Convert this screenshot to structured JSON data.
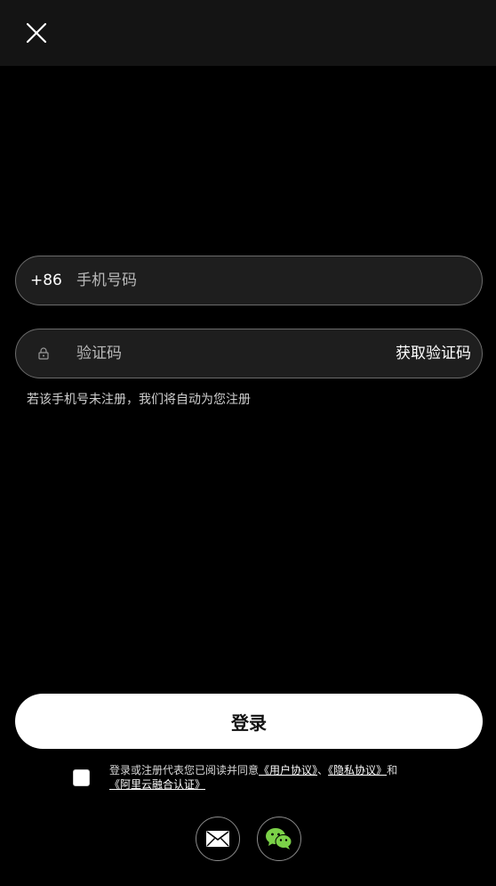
{
  "header": {
    "close_icon": "close-icon"
  },
  "form": {
    "country_code": "+86",
    "phone_placeholder": "手机号码",
    "phone_value": "",
    "code_icon": "lock-icon",
    "code_placeholder": "验证码",
    "code_value": "",
    "get_code_label": "获取验证码",
    "hint": "若该手机号未注册，我们将自动为您注册"
  },
  "login_label": "登录",
  "agreement": {
    "checked": false,
    "prefix": "登录或注册代表您已阅读并同意",
    "user_agreement": "《用户协议》",
    "separator": "、",
    "privacy_agreement": "《隐私协议》",
    "and": "和",
    "aliyun_auth": "《阿里云融合认证》"
  },
  "social": {
    "items": [
      {
        "icon": "mail-icon"
      },
      {
        "icon": "wechat-icon"
      }
    ]
  },
  "colors": {
    "background": "#000000",
    "topbar": "#141414",
    "field_bg": "#1e1e1e",
    "field_border": "#6b6b6b",
    "button_bg": "#ffffff",
    "wechat_green": "#7bd148"
  }
}
